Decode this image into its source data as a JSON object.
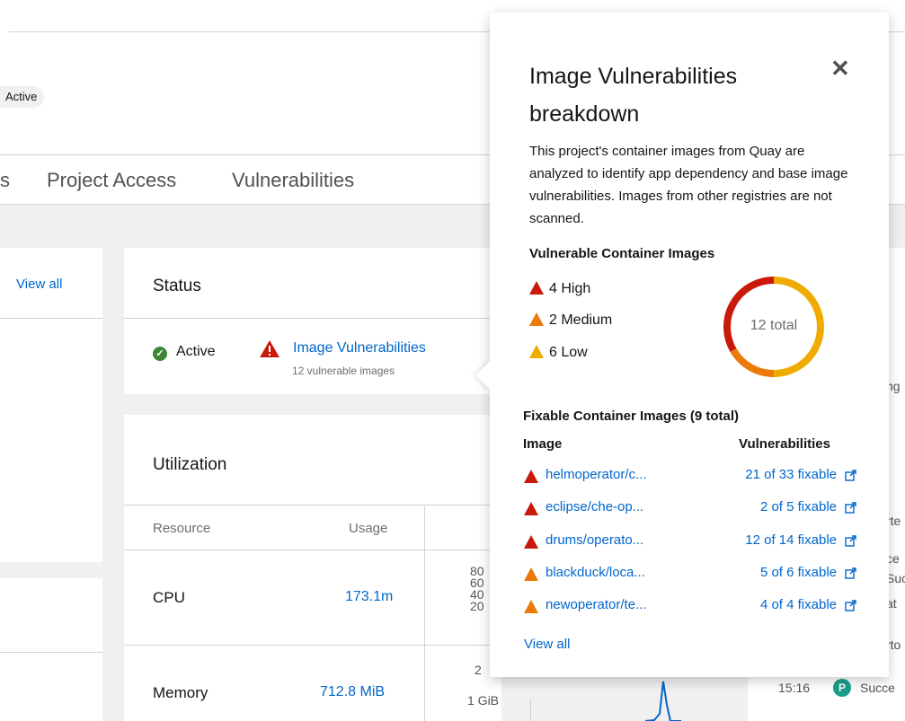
{
  "header": {
    "status_badge": "Active"
  },
  "tabs": [
    {
      "label": "s"
    },
    {
      "label": "Project Access"
    },
    {
      "label": "Vulnerabilities"
    }
  ],
  "left_card": {
    "view_all": "View all"
  },
  "status_card": {
    "title": "Status",
    "active_label": "Active",
    "vuln_link": "Image Vulnerabilities",
    "vuln_sub": "12 vulnerable images"
  },
  "utilization_card": {
    "title": "Utilization",
    "col_resource": "Resource",
    "col_usage": "Usage",
    "rows": [
      {
        "name": "CPU",
        "usage": "173.1m",
        "axis": [
          "80",
          "60",
          "40",
          "20"
        ]
      },
      {
        "name": "Memory",
        "usage": "712.8 MiB",
        "axis": [
          "2",
          "1 GiB"
        ]
      }
    ]
  },
  "right_card": {
    "fragments": [
      "ng",
      "rte",
      "ce",
      "Succ",
      "at",
      "rto"
    ],
    "event_time": "15:16",
    "event_badge": "P",
    "event_text": "Succe"
  },
  "popover": {
    "title": "Image Vulnerabilities breakdown",
    "close_label": "✕",
    "description": "This project's container images from Quay are analyzed to identify app dependency and base image vulnerabilities. Images from other registries are not scanned.",
    "vulnerable_heading": "Vulnerable Container Images",
    "severities": [
      {
        "label": "4 High",
        "count": 4,
        "color": "#c9190b"
      },
      {
        "label": "2 Medium",
        "count": 2,
        "color": "#ec7a08"
      },
      {
        "label": "6 Low",
        "count": 6,
        "color": "#f0ab00"
      }
    ],
    "donut_total_label": "12 total",
    "fixable_heading": "Fixable Container Images (9 total)",
    "col_image": "Image",
    "col_vulnerabilities": "Vulnerabilities",
    "images": [
      {
        "name": "helmoperator/c...",
        "fixable": "21 of 33 fixable",
        "severity_color": "#c9190b"
      },
      {
        "name": "eclipse/che-op...",
        "fixable": "2 of 5 fixable",
        "severity_color": "#c9190b"
      },
      {
        "name": "drums/operato...",
        "fixable": "12 of 14 fixable",
        "severity_color": "#c9190b"
      },
      {
        "name": "blackduck/loca...",
        "fixable": "5 of 6 fixable",
        "severity_color": "#ec7a08"
      },
      {
        "name": "newoperator/te...",
        "fixable": "4 of 4 fixable",
        "severity_color": "#ec7a08"
      }
    ],
    "view_all": "View all"
  },
  "colors": {
    "link": "#0066cc",
    "high": "#c9190b",
    "medium": "#ec7a08",
    "low": "#f0ab00",
    "success": "#3e8635"
  }
}
